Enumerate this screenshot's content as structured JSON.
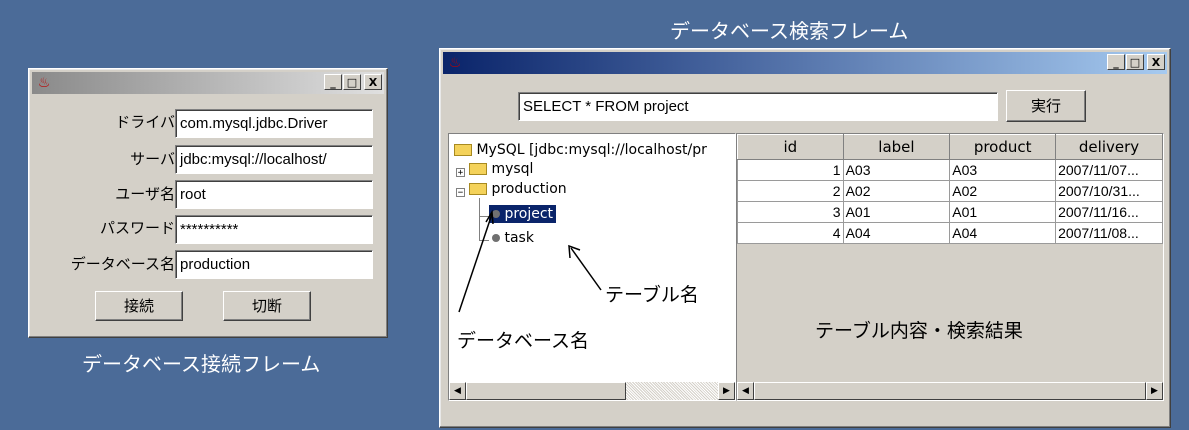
{
  "captions": {
    "search_frame": "データベース検索フレーム",
    "connect_frame": "データベース接続フレーム"
  },
  "connect_window": {
    "labels": {
      "driver": "ドライバ",
      "server": "サーバ",
      "user": "ユーザ名",
      "password": "パスワード",
      "database": "データベース名"
    },
    "values": {
      "driver": "com.mysql.jdbc.Driver",
      "server": "jdbc:mysql://localhost/",
      "user": "root",
      "password": "**********",
      "database": "production"
    },
    "buttons": {
      "connect": "接続",
      "disconnect": "切断"
    },
    "window_buttons": {
      "minimize": "_",
      "maximize": "□",
      "close": "X"
    }
  },
  "search_window": {
    "query": "SELECT * FROM project",
    "execute_label": "実行",
    "window_buttons": {
      "minimize": "_",
      "maximize": "□",
      "close": "X"
    },
    "tree": {
      "root": "MySQL [jdbc:mysql://localhost/pr",
      "nodes": [
        "mysql",
        "production"
      ],
      "tables": [
        "project",
        "task"
      ]
    },
    "table": {
      "columns": [
        "id",
        "label",
        "product",
        "delivery"
      ],
      "rows": [
        [
          "1",
          "A03",
          "A03",
          "2007/11/07..."
        ],
        [
          "2",
          "A02",
          "A02",
          "2007/10/31..."
        ],
        [
          "3",
          "A01",
          "A01",
          "2007/11/16..."
        ],
        [
          "4",
          "A04",
          "A04",
          "2007/11/08..."
        ]
      ]
    },
    "annotations": {
      "table_name": "テーブル名",
      "database_name": "データベース名",
      "table_content": "テーブル内容・検索結果"
    },
    "scroll_arrows": {
      "left": "◀",
      "right": "▶"
    }
  },
  "icons": {
    "java": "java-cup-icon",
    "folder": "folder-icon",
    "table": "table-node-icon"
  }
}
